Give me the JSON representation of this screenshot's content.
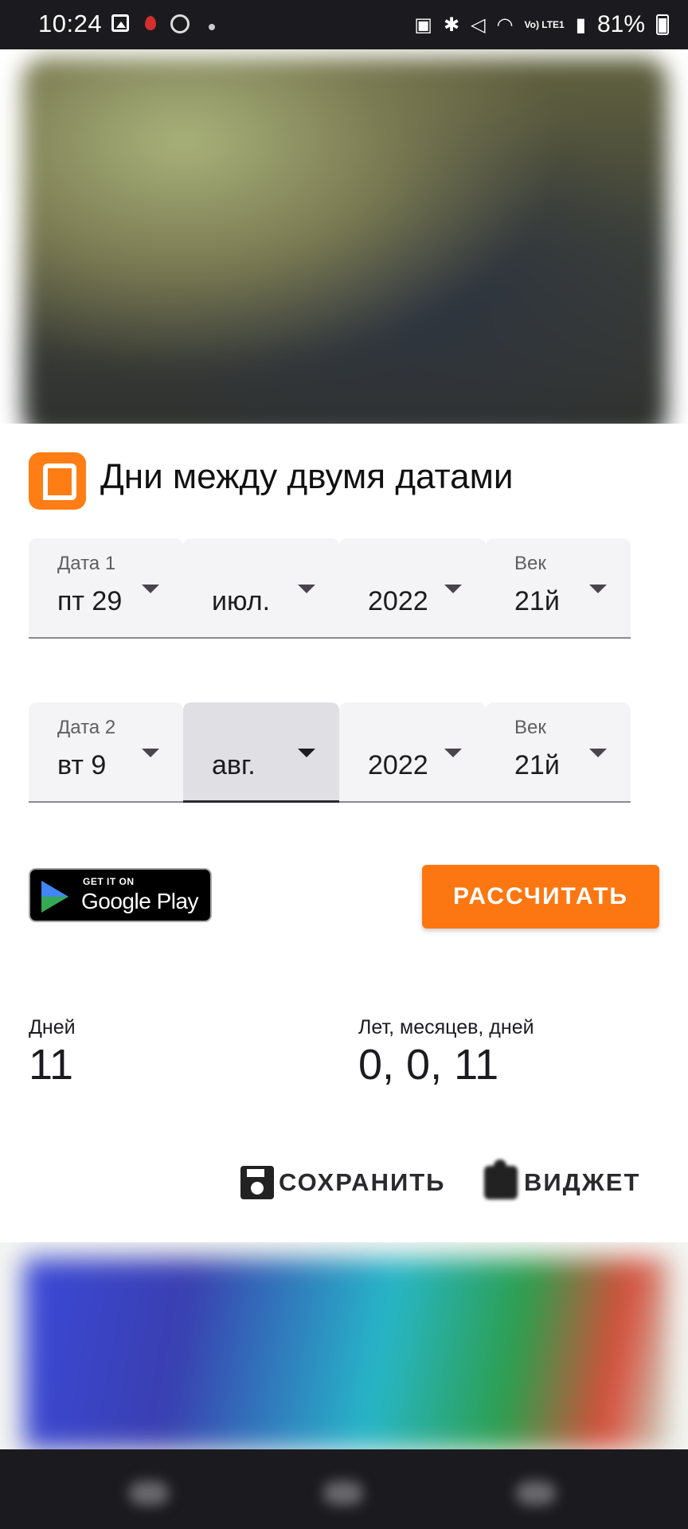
{
  "status_bar": {
    "time": "10:24",
    "battery": "81%",
    "network_label": "Vo) LTE1",
    "icons": [
      "gallery-icon",
      "notification-icon",
      "circle-icon",
      "dot-icon",
      "nfc-icon",
      "bluetooth-icon",
      "mute-icon",
      "wifi-icon",
      "signal-icon",
      "battery-icon"
    ]
  },
  "app": {
    "title": "Дни между двумя датами",
    "accent_color": "#fc7712"
  },
  "date1": {
    "label": "Дата 1",
    "day": "пт 29",
    "month": "июл.",
    "year": "2022",
    "century_label": "Век",
    "century": "21й"
  },
  "date2": {
    "label": "Дата 2",
    "day": "вт 9",
    "month": "авг.",
    "year": "2022",
    "century_label": "Век",
    "century": "21й"
  },
  "google_play": {
    "small": "GET IT ON",
    "big": "Google Play"
  },
  "actions": {
    "calculate": "РАССЧИТАТЬ",
    "save": "СОХРАНИТЬ",
    "widget": "ВИДЖЕТ"
  },
  "results": {
    "days_label": "Дней",
    "days_value": "11",
    "ymd_label": "Лет, месяцев, дней",
    "ymd_value": "0, 0, 11"
  }
}
